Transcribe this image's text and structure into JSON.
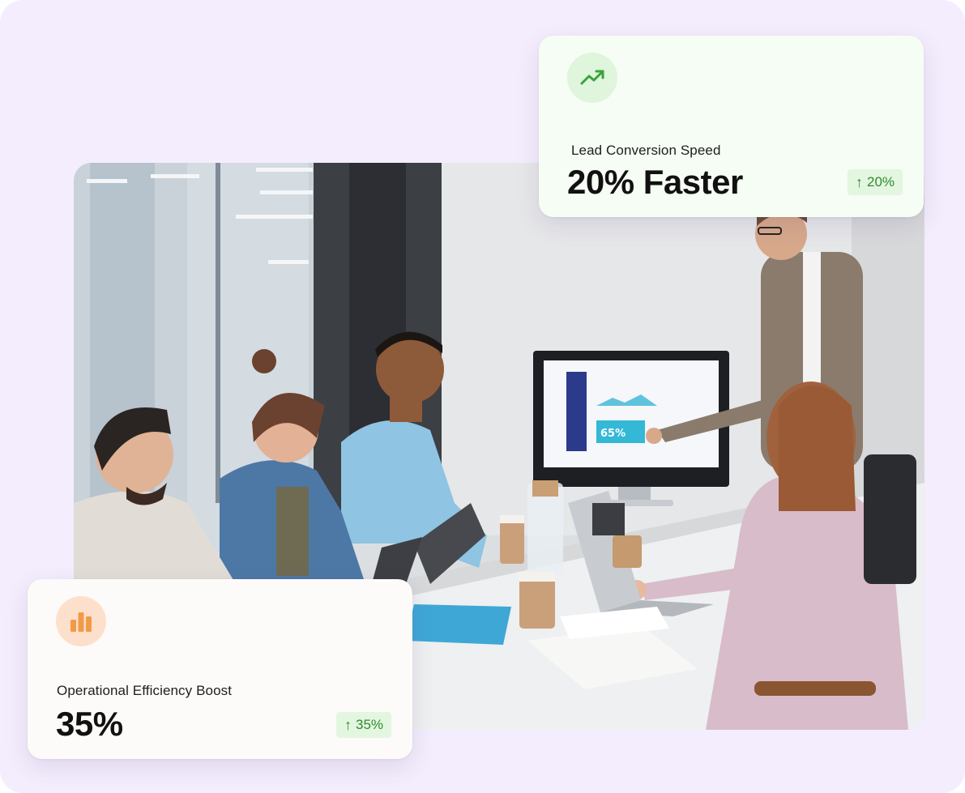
{
  "cards": {
    "lead": {
      "icon": "trending-up-icon",
      "label": "Lead Conversion Speed",
      "value": "20% Faster",
      "badge": "20%",
      "badge_arrow": "↑",
      "accent": "#3aa33a"
    },
    "efficiency": {
      "icon": "bar-chart-icon",
      "label": "Operational Efficiency Boost",
      "value": "35%",
      "badge": "35%",
      "badge_arrow": "↑",
      "accent": "#f08c3a"
    }
  },
  "photo": {
    "scene": "team-meeting-photo",
    "monitor_text": "65%"
  },
  "colors": {
    "background": "#f4edfd",
    "badge_bg": "#e3f6df",
    "badge_text": "#2f8a2f"
  }
}
